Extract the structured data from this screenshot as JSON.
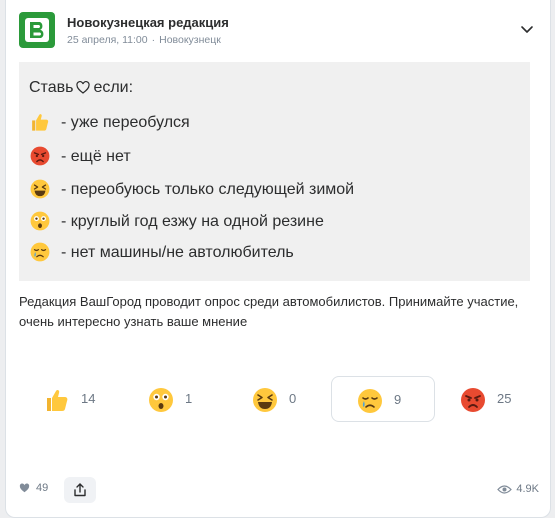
{
  "post": {
    "author": "Новокузнецкая редакция",
    "date": "25 апреля, 11:00",
    "separator": "·",
    "location": "Новокузнецк",
    "logo_letter": "В",
    "logo_color": "#2b9a3a"
  },
  "poll": {
    "title_before": "Ставь",
    "title_after": "если:",
    "options": [
      {
        "emoji": "thumbs-up-icon",
        "text": "- уже переобулся"
      },
      {
        "emoji": "angry-face-icon",
        "text": "- ещё нет"
      },
      {
        "emoji": "laughing-face-icon",
        "text": "- переобуюсь только следующей зимой"
      },
      {
        "emoji": "astonished-face-icon",
        "text": "- круглый год езжу на одной резине"
      },
      {
        "emoji": "crying-face-icon",
        "text": "- нет машины/не автолюбитель"
      }
    ]
  },
  "body_text": "Редакция ВашГород проводит опрос среди автомобилистов. Принимайте участие, очень интересно узнать ваше мнение",
  "reactions": [
    {
      "emoji": "thumbs-up-icon",
      "count": "14"
    },
    {
      "emoji": "astonished-face-icon",
      "count": "1"
    },
    {
      "emoji": "laughing-face-icon",
      "count": "0"
    },
    {
      "emoji": "crying-face-icon",
      "count": "9",
      "selected": true
    },
    {
      "emoji": "angry-face-icon",
      "count": "25"
    }
  ],
  "footer": {
    "likes": "49",
    "views": "4.9K"
  }
}
